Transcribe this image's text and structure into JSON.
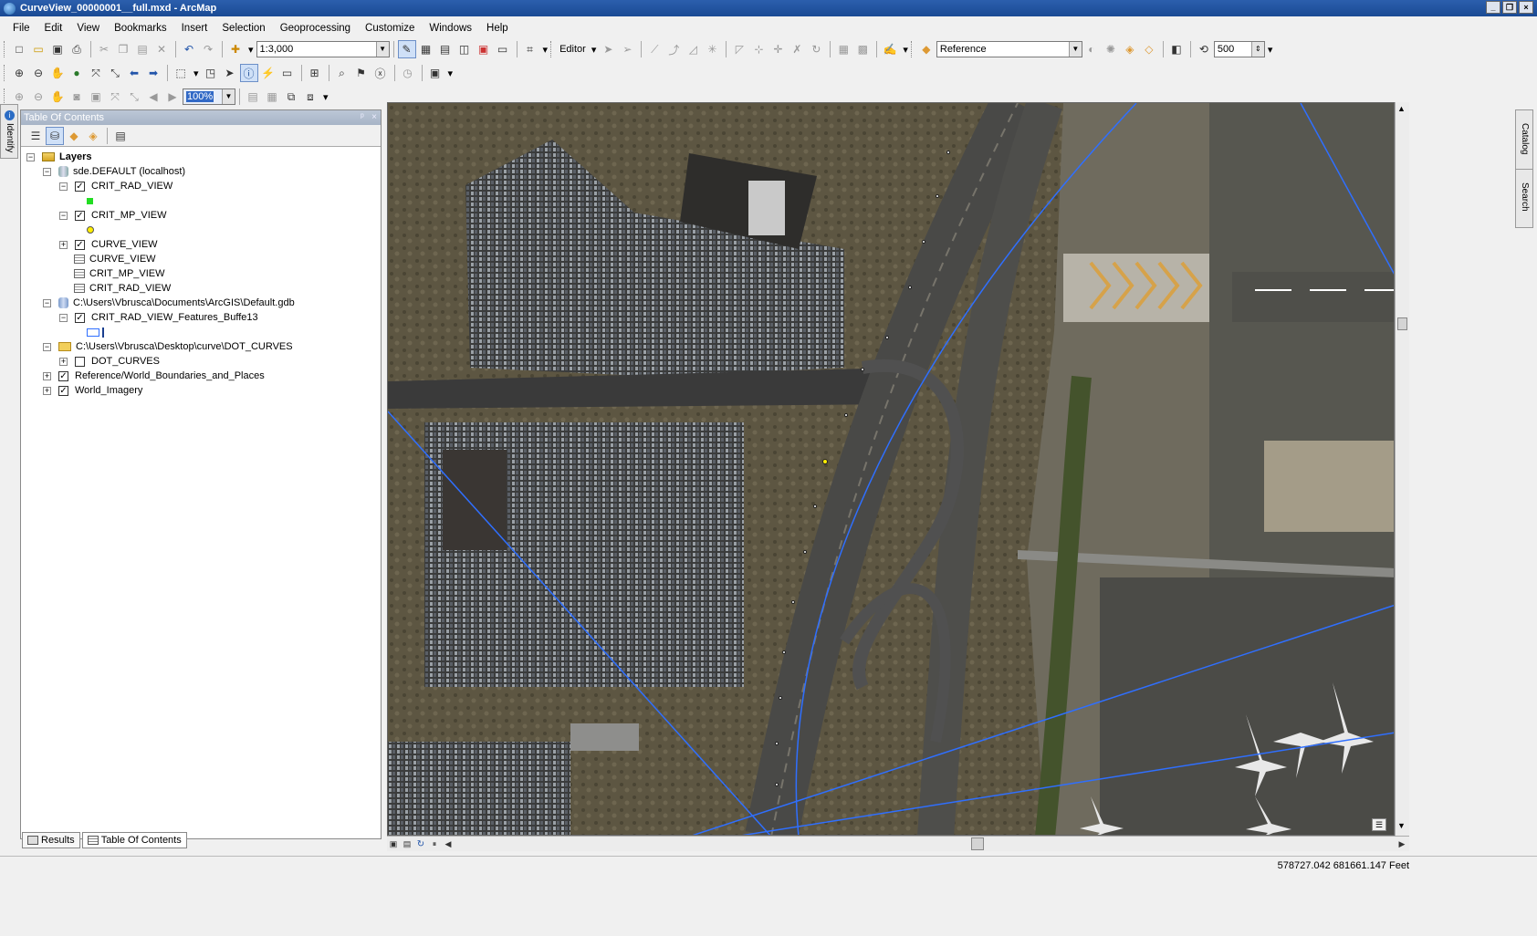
{
  "window": {
    "title": "CurveView_00000001__full.mxd - ArcMap",
    "minimize": "_",
    "maximize": "❐",
    "close": "×"
  },
  "menu": [
    "File",
    "Edit",
    "View",
    "Bookmarks",
    "Insert",
    "Selection",
    "Geoprocessing",
    "Customize",
    "Windows",
    "Help"
  ],
  "toolbar": {
    "scale": "1:3,000",
    "editor_label": "Editor",
    "reference_layer": "Reference",
    "distance_value": "500",
    "zoom_percent": "100%"
  },
  "toc": {
    "title": "Table Of Contents",
    "pin": "ᵖ",
    "close": "×",
    "root_label": "Layers",
    "rows": [
      {
        "label": "sde.DEFAULT (localhost)",
        "expander": "−",
        "checkbox": null,
        "icon": "database-icon"
      },
      {
        "label": "CRIT_RAD_VIEW",
        "expander": "−",
        "checkbox": "✓",
        "icon": null
      },
      {
        "label": "",
        "expander": null,
        "checkbox": null,
        "icon": "green-square-symbol"
      },
      {
        "label": "CRIT_MP_VIEW",
        "expander": "−",
        "checkbox": "✓",
        "icon": null
      },
      {
        "label": "",
        "expander": null,
        "checkbox": null,
        "icon": "yellow-point-symbol"
      },
      {
        "label": "CURVE_VIEW",
        "expander": "+",
        "checkbox": "✓",
        "icon": null
      },
      {
        "label": "CURVE_VIEW",
        "expander": null,
        "checkbox": null,
        "icon": "table-icon"
      },
      {
        "label": "CRIT_MP_VIEW",
        "expander": null,
        "checkbox": null,
        "icon": "table-icon"
      },
      {
        "label": "CRIT_RAD_VIEW",
        "expander": null,
        "checkbox": null,
        "icon": "table-icon"
      },
      {
        "label": "C:\\Users\\Vbrusca\\Documents\\ArcGIS\\Default.gdb",
        "expander": "−",
        "checkbox": null,
        "icon": "geodatabase-icon"
      },
      {
        "label": "CRIT_RAD_VIEW_Features_Buffe13",
        "expander": "−",
        "checkbox": "✓",
        "icon": null
      },
      {
        "label": "",
        "expander": null,
        "checkbox": null,
        "icon": "blue-outline-polygon-symbol"
      },
      {
        "label": "C:\\Users\\Vbrusca\\Desktop\\curve\\DOT_CURVES",
        "expander": "−",
        "checkbox": null,
        "icon": "folder-icon"
      },
      {
        "label": "DOT_CURVES",
        "expander": "+",
        "checkbox": "",
        "icon": null
      },
      {
        "label": "Reference/World_Boundaries_and_Places",
        "expander": "+",
        "checkbox": "✓",
        "icon": null
      },
      {
        "label": "World_Imagery",
        "expander": "+",
        "checkbox": "✓",
        "icon": null
      }
    ]
  },
  "bottom_tabs": [
    {
      "label": "Results",
      "icon": "results-icon"
    },
    {
      "label": "Table Of Contents",
      "icon": "toc-icon"
    }
  ],
  "side_tabs": {
    "left": "Identify",
    "right_catalog": "Catalog",
    "right_search": "Search"
  },
  "status": {
    "coordinates": "578727.042  681661.147 Feet"
  },
  "colors": {
    "titlebar": "#1a4a94",
    "route_line": "#2f6fff",
    "point_marker": "#ffffff",
    "symbol_green": "#22dd22",
    "symbol_yellow": "#ffee00"
  }
}
